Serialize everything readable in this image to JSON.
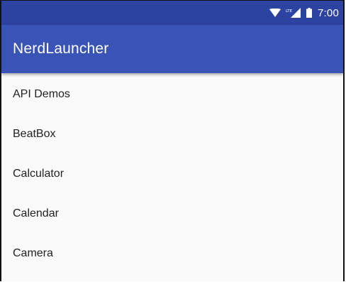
{
  "status_bar": {
    "time": "7:00",
    "network_label": "LTE",
    "icons": [
      "wifi-icon",
      "lte-signal-icon",
      "battery-icon"
    ]
  },
  "app_bar": {
    "title": "NerdLauncher",
    "color": "#3a53b6",
    "status_color": "#2d43a1"
  },
  "apps": [
    {
      "label": "API Demos"
    },
    {
      "label": "BeatBox"
    },
    {
      "label": "Calculator"
    },
    {
      "label": "Calendar"
    },
    {
      "label": "Camera"
    }
  ]
}
